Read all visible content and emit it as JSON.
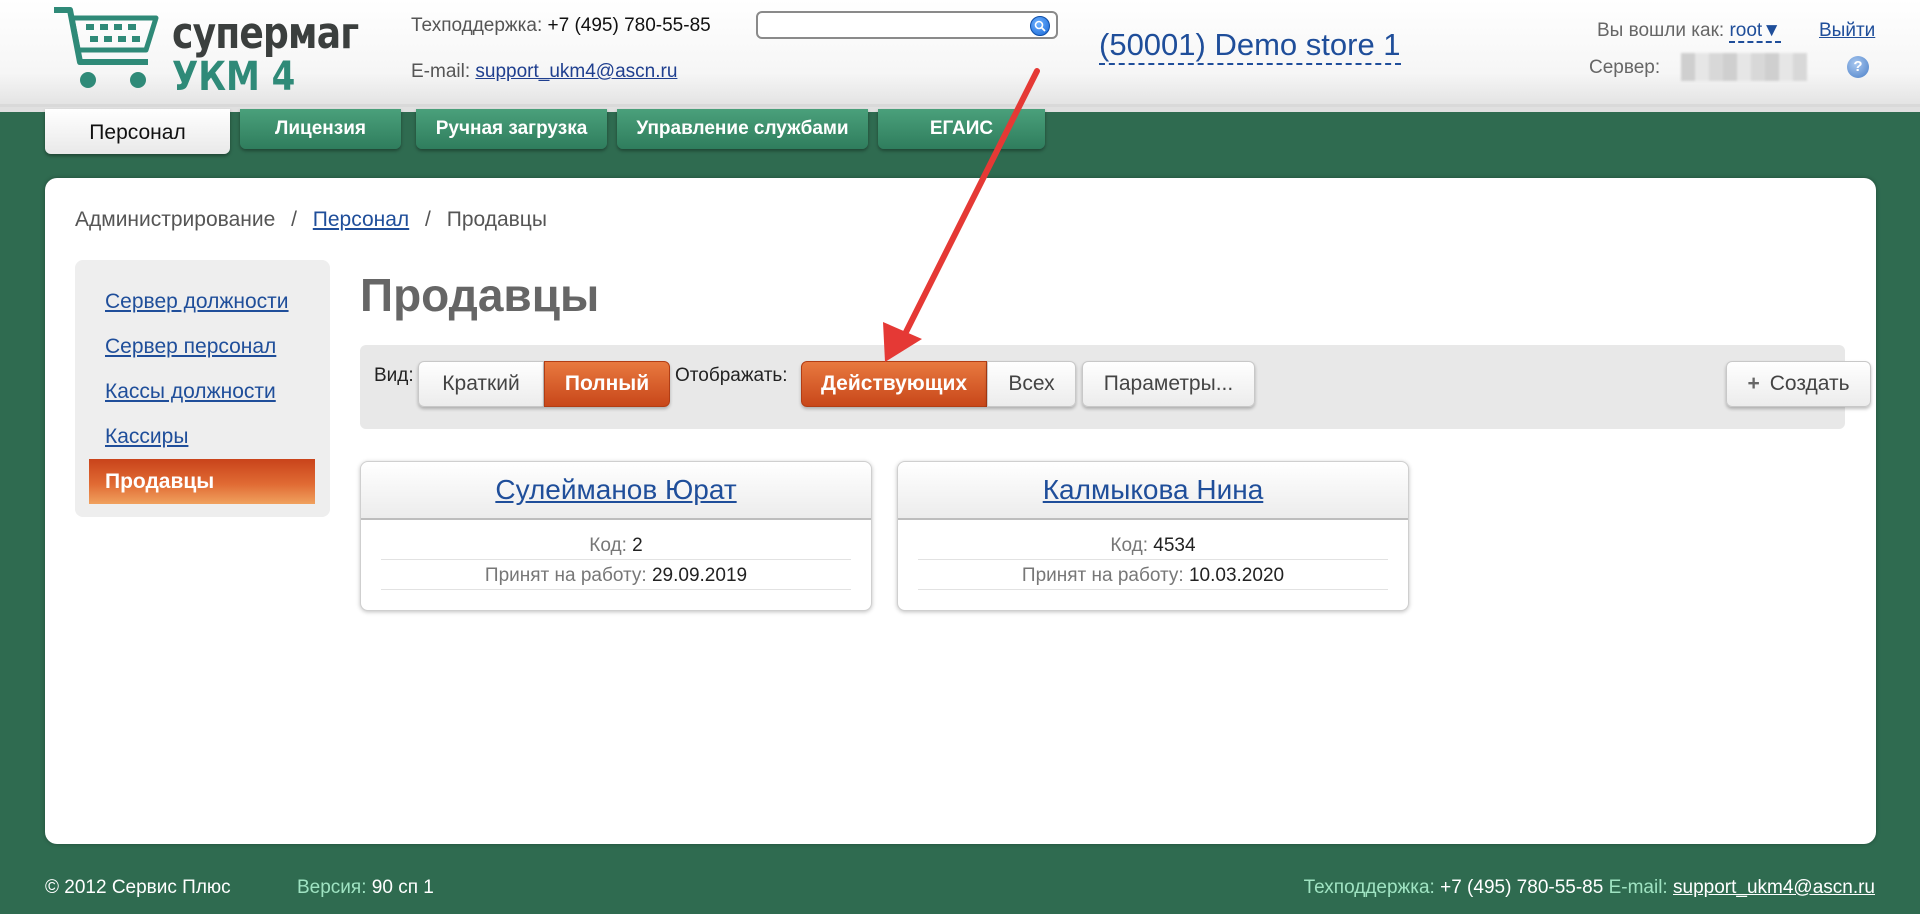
{
  "header": {
    "logo_line1": "супермаг",
    "logo_line2": "УКМ 4",
    "support_label": "Техподдержка:",
    "support_phone": "+7 (495) 780-55-85",
    "email_label": "E-mail:",
    "email": "support_ukm4@ascn.ru",
    "search_placeholder": "",
    "store": "(50001) Demo store 1",
    "logged_in_label": "Вы вошли как:",
    "user": "root",
    "logout": "Выйти",
    "server_label": "Сервер:",
    "help_glyph": "?"
  },
  "tabs": [
    {
      "label": "Персонал",
      "active": true
    },
    {
      "label": "Лицензия"
    },
    {
      "label": "Ручная загрузка"
    },
    {
      "label": "Управление службами"
    },
    {
      "label": "ЕГАИС"
    }
  ],
  "breadcrumb": {
    "root": "Администрирование",
    "section": "Персонал",
    "current": "Продавцы",
    "separator": "/"
  },
  "sidebar": {
    "items": [
      {
        "label": "Сервер должности"
      },
      {
        "label": "Сервер персонал"
      },
      {
        "label": "Кассы должности"
      },
      {
        "label": "Кассиры"
      },
      {
        "label": "Продавцы",
        "active": true
      }
    ]
  },
  "main": {
    "title": "Продавцы",
    "toolbar": {
      "view_label": "Вид:",
      "view_short": "Краткий",
      "view_full": "Полный",
      "show_label": "Отображать:",
      "show_active": "Действующих",
      "show_all": "Всех",
      "params": "Параметры...",
      "create_icon": "+",
      "create": "Создать"
    },
    "cards": [
      {
        "name": "Сулейманов Юрат",
        "code_label": "Код:",
        "code": "2",
        "hired_label": "Принят на работу:",
        "hired": "29.09.2019"
      },
      {
        "name": "Калмыкова Нина",
        "code_label": "Код:",
        "code": "4534",
        "hired_label": "Принят на работу:",
        "hired": "10.03.2020"
      }
    ]
  },
  "footer": {
    "copyright": "© 2012 Сервис Плюс",
    "version_label": "Версия:",
    "version": "90 сп 1",
    "support_label": "Техподдержка:",
    "support_phone": "+7 (495) 780-55-85",
    "email_label": "E-mail:",
    "email": "support_ukm4@ascn.ru"
  },
  "colors": {
    "brand_green": "#2f6b50",
    "accent_orange": "#d9582a",
    "link_blue": "#1f4e9a",
    "annotation_arrow": "#e53935"
  }
}
